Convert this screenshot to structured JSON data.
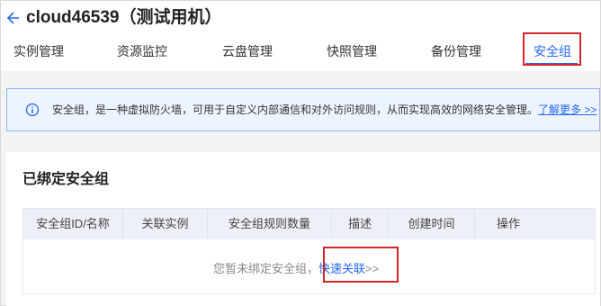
{
  "header": {
    "title": "cloud46539（测试用机）"
  },
  "tabs": [
    {
      "label": "实例管理"
    },
    {
      "label": "资源监控"
    },
    {
      "label": "云盘管理"
    },
    {
      "label": "快照管理"
    },
    {
      "label": "备份管理"
    },
    {
      "label": "安全组",
      "active": true
    }
  ],
  "notice": {
    "text": "安全组，是一种虚拟防火墙，可用于自定义内部通信和对外访问规则，从而实现高效的网络安全管理。",
    "link": "了解更多 >>"
  },
  "section": {
    "title": "已绑定安全组"
  },
  "table": {
    "columns": [
      "安全组ID/名称",
      "关联实例",
      "安全组规则数量",
      "描述",
      "创建时间",
      "操作"
    ],
    "empty_text": "您暂未绑定安全组，",
    "empty_link": "快速关联",
    "empty_arrows": ">>"
  },
  "colors": {
    "accent": "#2468f2",
    "highlight_box": "#d6252b",
    "notice_bg": "#eef4ff"
  }
}
